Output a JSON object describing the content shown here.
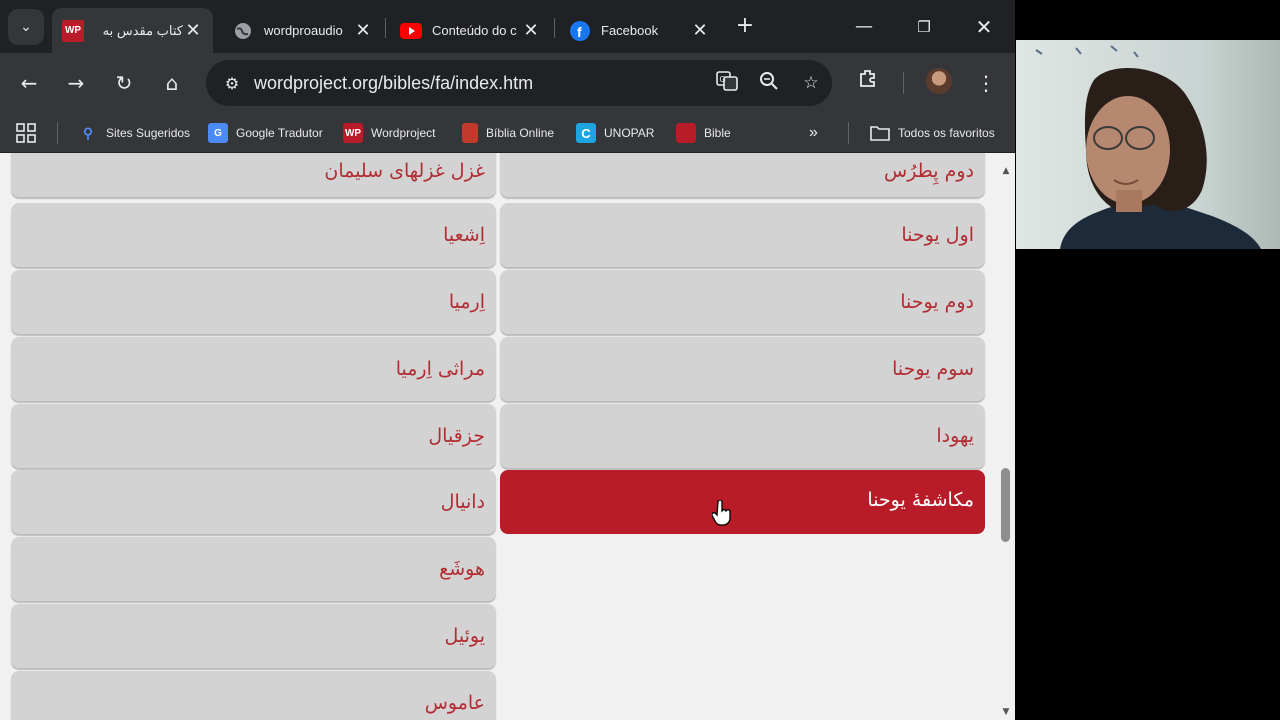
{
  "tabs": [
    {
      "title": "کتاب مقدس به",
      "favicon": "WP",
      "active": true
    },
    {
      "title": "wordproaudio",
      "favicon": "globe-icon",
      "active": false
    },
    {
      "title": "Conteúdo do c",
      "favicon": "youtube-icon",
      "active": false
    },
    {
      "title": "Facebook",
      "favicon": "facebook-icon",
      "active": false
    }
  ],
  "address_bar": {
    "url": "wordproject.org/bibles/fa/index.htm"
  },
  "bookmarks": {
    "items": [
      {
        "label": "Sites Sugeridos"
      },
      {
        "label": "Google Tradutor"
      },
      {
        "label": "Wordproject"
      },
      {
        "label": "Bíblia Online"
      },
      {
        "label": "UNOPAR"
      },
      {
        "label": "Bible"
      }
    ],
    "all_bookmarks": "Todos os favoritos"
  },
  "books_left": [
    "غزل غزلهای سلیمان",
    "اِشعیا",
    "اِرمیا",
    "مراثی اِرمیا",
    "حِزقیال",
    "دانیال",
    "هوشَع",
    "یوئیل",
    "عاموس"
  ],
  "books_right": [
    "دوم پِطرُس",
    "اول یوحنا",
    "دوم یوحنا",
    "سوم یوحنا",
    "یهودا",
    "مکاشفهٔ یوحنا"
  ],
  "selected_book": "مکاشفهٔ یوحنا",
  "colors": {
    "accent": "#b71c28",
    "book_text": "#b22d33",
    "card": "#d3d3d3"
  }
}
